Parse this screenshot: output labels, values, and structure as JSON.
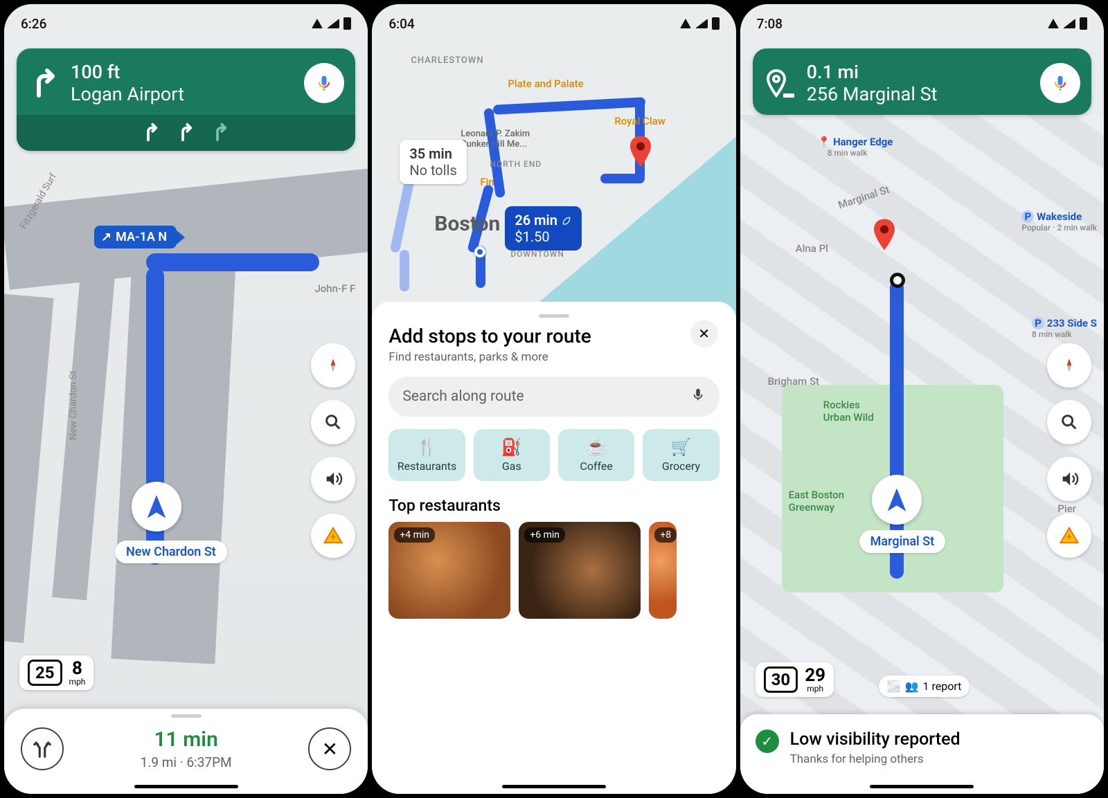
{
  "p1": {
    "time": "6:26",
    "banner": {
      "distance": "100 ft",
      "destination": "Logan Airport"
    },
    "route_shield": "MA-1A N",
    "street_label": "New Chardon St",
    "speed_limit": "25",
    "speed_value": "8",
    "speed_unit": "mph",
    "eta": {
      "duration": "11 min",
      "distance": "1.9 mi",
      "arrival": "6:37PM"
    },
    "road_text_1": "Fitzgerald Surf",
    "road_text_2": "New Chardon St",
    "road_text_3": "John-F F"
  },
  "p2": {
    "time": "6:04",
    "alt_route": {
      "duration": "35 min",
      "note": "No tolls"
    },
    "sel_route": {
      "duration": "26 min",
      "toll": "$1.50"
    },
    "city": "Boston",
    "poi": {
      "plate": "Plate and Palate",
      "royal": "Royal Claw",
      "fin": "Fin",
      "charlestown": "CHARLESTOWN",
      "northend": "NORTH END",
      "downtown": "DOWNTOWN",
      "zakim": "Leonard P. Zakim\nBunker Hill Me..."
    },
    "sheet": {
      "title": "Add stops to your route",
      "subtitle": "Find restaurants, parks & more",
      "search_placeholder": "Search along route",
      "chips": {
        "restaurants": "Restaurants",
        "gas": "Gas",
        "coffee": "Coffee",
        "grocery": "Grocery"
      },
      "section": "Top restaurants",
      "card1_badge": "+4 min",
      "card2_badge": "+6 min",
      "card3_badge": "+8"
    }
  },
  "p3": {
    "time": "7:08",
    "banner": {
      "distance": "0.1 mi",
      "destination": "256 Marginal St"
    },
    "poi": {
      "hanger": "Hanger Edge",
      "hanger_sub": "8 min walk",
      "wakeside": "Wakeside",
      "wakeside_sub": "Popular · 2 min walk",
      "side233": "233 Side S",
      "side233_sub": "8 min walk",
      "marginal": "Marginal St",
      "alna": "Alna Pl",
      "brigham": "Brigham St",
      "eastboston": "East Boston\nGreenway",
      "rockies": "Rockies\nUrban Wild",
      "pier": "Pier"
    },
    "street_label": "Marginal St",
    "speed_limit": "30",
    "speed_value": "29",
    "speed_unit": "mph",
    "report": "1 report",
    "toast": {
      "title": "Low visibility reported",
      "subtitle": "Thanks for helping others"
    }
  }
}
